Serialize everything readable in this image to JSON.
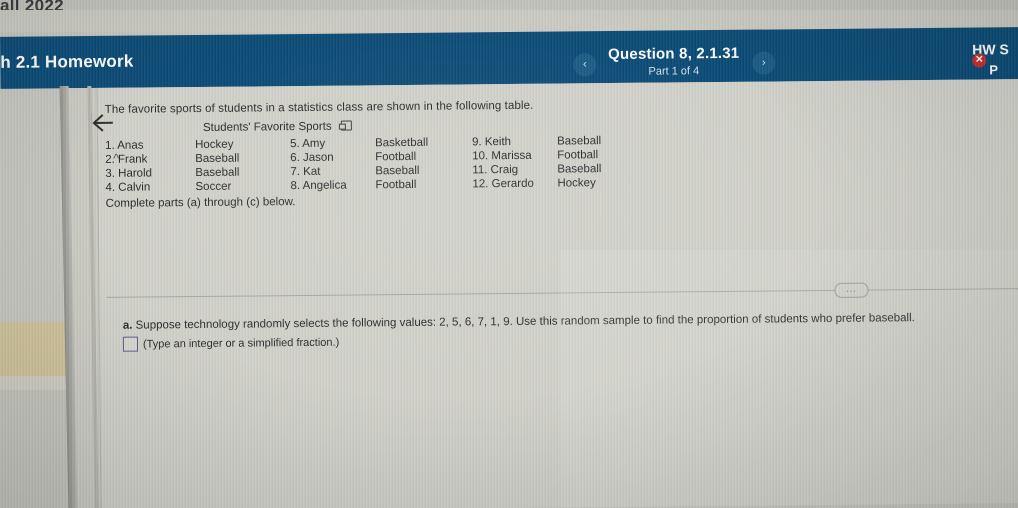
{
  "environment": {
    "top_partial_text": "all 2022"
  },
  "topbar": {
    "homework_title": "h 2.1 Homework",
    "question_title": "Question 8, 2.1.31",
    "part_label": "Part 1 of 4",
    "prev_icon": "‹",
    "next_icon": "›",
    "hw_score_label": "HW S",
    "points_label": "P",
    "error_icon": "✕",
    "bar_color": "#0b4b76"
  },
  "leftrail": {
    "back_icon": "back-to-start-icon",
    "collapse_icon": "^"
  },
  "question": {
    "intro": "The favorite sports of students in a statistics class are shown in the following table.",
    "table_title": "Students' Favorite Sports",
    "complete_text": "Complete parts (a) through (c) below.",
    "rows": [
      {
        "n1": "1. Anas",
        "s1": "Hockey",
        "n2": "5. Amy",
        "s2": "Basketball",
        "n3": "9. Keith",
        "s3": "Baseball"
      },
      {
        "n1": "2. Frank",
        "s1": "Baseball",
        "n2": "6. Jason",
        "s2": "Football",
        "n3": "10. Marissa",
        "s3": "Football"
      },
      {
        "n1": "3. Harold",
        "s1": "Baseball",
        "n2": "7. Kat",
        "s2": "Baseball",
        "n3": "11. Craig",
        "s3": "Baseball"
      },
      {
        "n1": "4. Calvin",
        "s1": "Soccer",
        "n2": "8. Angelica",
        "s2": "Football",
        "n3": "12. Gerardo",
        "s3": "Hockey"
      }
    ]
  },
  "divider": {
    "more_label": "..."
  },
  "part_a": {
    "marker": "a.",
    "text": "Suppose technology randomly selects the following values: 2, 5, 6, 7, 1, 9. Use this random sample to find the proportion of students who prefer baseball.",
    "answer_value": "",
    "answer_hint": "(Type an integer or a simplified fraction.)"
  }
}
